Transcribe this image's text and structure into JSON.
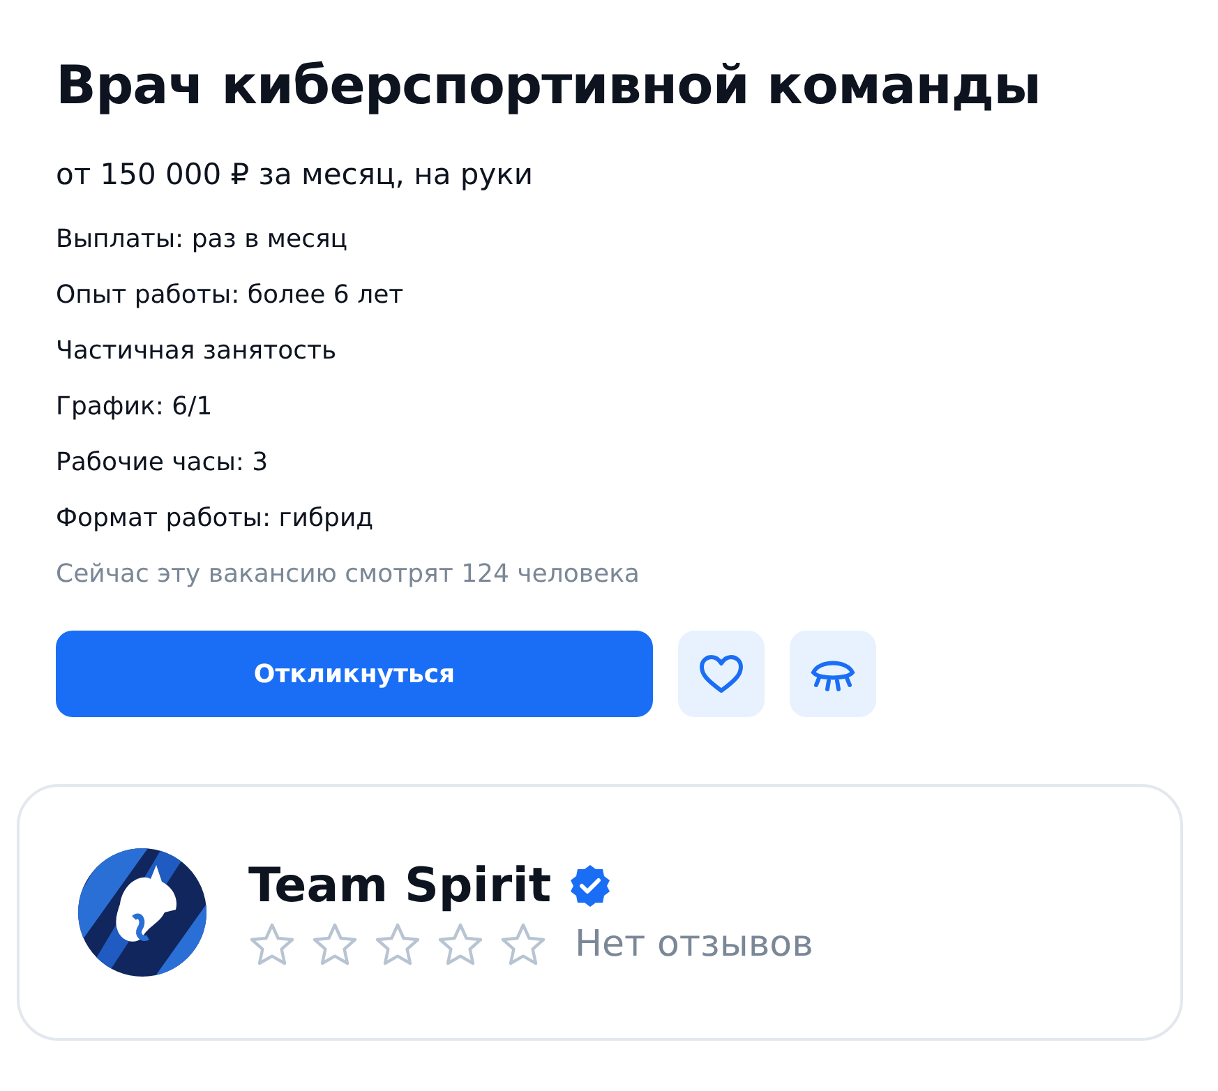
{
  "vacancy": {
    "title": "Врач киберспортивной команды",
    "salary": "от 150 000 ₽ за месяц, на руки",
    "details": [
      "Выплаты: раз в месяц",
      "Опыт работы: более 6 лет",
      "Частичная занятость",
      "График: 6/1",
      "Рабочие часы: 3",
      "Формат работы: гибрид"
    ],
    "viewers": "Сейчас эту вакансию смотрят 124 человека",
    "apply_button": "Откликнуться",
    "favorite": false
  },
  "company": {
    "name": "Team Spirit",
    "verified": true,
    "stars": 0,
    "reviews": "Нет отзывов"
  }
}
